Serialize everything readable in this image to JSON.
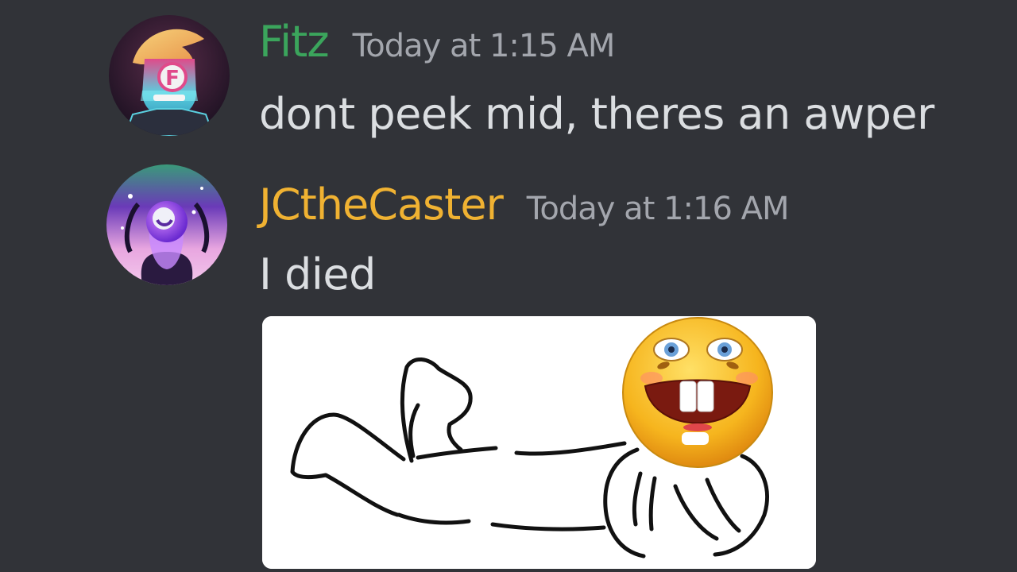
{
  "messages": [
    {
      "username": "Fitz",
      "username_color": "#3ba55c",
      "timestamp": "Today at 1:15 AM",
      "content": "dont peek mid, theres an awper",
      "avatar_icon": "robot-skull-avatar-icon"
    },
    {
      "username": "JCtheCaster",
      "username_color": "#f0b232",
      "timestamp": "Today at 1:16 AM",
      "content": "I died",
      "avatar_icon": "galaxy-face-avatar-icon",
      "attachment_icon": "lying-stick-figure-laughing-emoji-meme"
    }
  ],
  "colors": {
    "background": "#313338",
    "message_text": "#dbdee1",
    "timestamp": "#a3a6ad"
  }
}
